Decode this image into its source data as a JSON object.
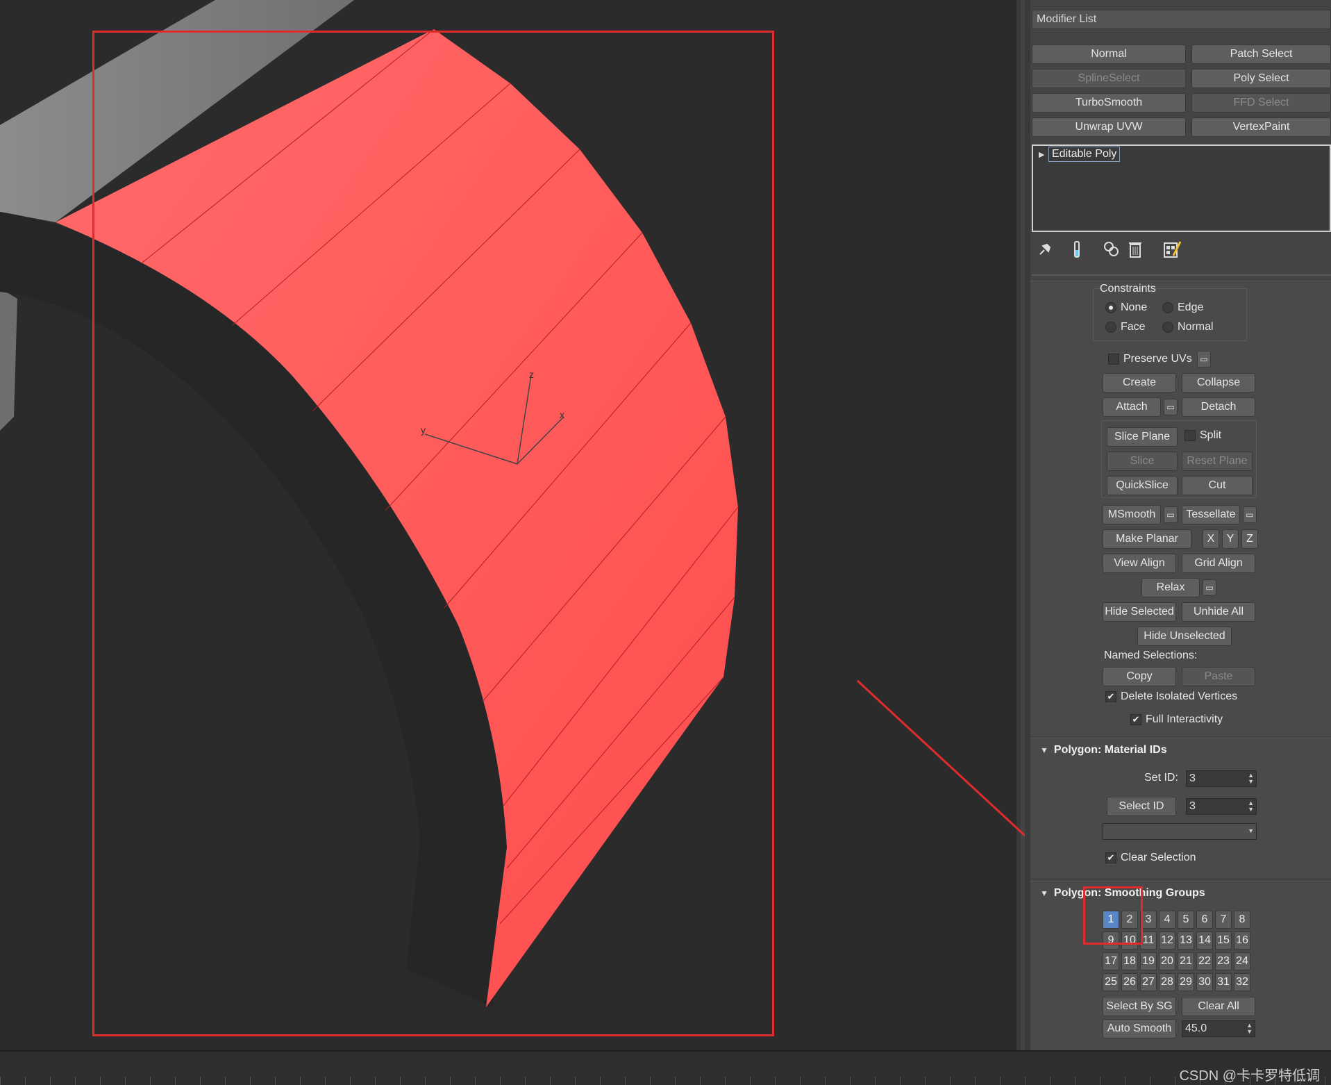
{
  "colors": {
    "selection_red": "#ff6060",
    "annotation_red": "#e02c2c",
    "panel_bg": "#444444",
    "viewport_bg": "#2b2b2b",
    "active_sg": "#5a86c5"
  },
  "viewport": {
    "gizmo": {
      "z": "z",
      "x": "x",
      "y": "y"
    }
  },
  "modifier_list": {
    "label": "Modifier List"
  },
  "modifier_buttons": {
    "normal": "Normal",
    "patch_select": "Patch Select",
    "spline_select": "SplineSelect",
    "poly_select": "Poly Select",
    "turbosmooth": "TurboSmooth",
    "ffd_select": "FFD Select",
    "unwrap_uvw": "Unwrap UVW",
    "vertexpaint": "VertexPaint"
  },
  "stack": {
    "item": "Editable Poly"
  },
  "stack_tools": [
    "pin-stack-icon",
    "show-end-result-icon",
    "make-unique-icon",
    "remove-modifier-icon",
    "configure-sets-icon"
  ],
  "edit_geometry": {
    "constraints_label": "Constraints",
    "constraints": {
      "none": "None",
      "edge": "Edge",
      "face": "Face",
      "normal": "Normal"
    },
    "preserve_uvs": "Preserve UVs",
    "create": "Create",
    "collapse": "Collapse",
    "attach": "Attach",
    "detach": "Detach",
    "slice_plane": "Slice Plane",
    "split": "Split",
    "slice": "Slice",
    "reset_plane": "Reset Plane",
    "quickslice": "QuickSlice",
    "cut": "Cut",
    "msmooth": "MSmooth",
    "tessellate": "Tessellate",
    "make_planar": "Make Planar",
    "x": "X",
    "y": "Y",
    "z": "Z",
    "view_align": "View Align",
    "grid_align": "Grid Align",
    "relax": "Relax",
    "hide_selected": "Hide Selected",
    "unhide_all": "Unhide All",
    "hide_unselected": "Hide Unselected",
    "named_selections": "Named Selections:",
    "copy": "Copy",
    "paste": "Paste",
    "delete_isolated": "Delete Isolated Vertices",
    "full_interactivity": "Full Interactivity"
  },
  "material_ids": {
    "title": "Polygon: Material IDs",
    "set_id_label": "Set ID:",
    "set_id_value": "3",
    "select_id": "Select ID",
    "select_id_value": "3",
    "clear_selection": "Clear Selection"
  },
  "smoothing_groups": {
    "title": "Polygon: Smoothing Groups",
    "groups": [
      "1",
      "2",
      "3",
      "4",
      "5",
      "6",
      "7",
      "8",
      "9",
      "10",
      "11",
      "12",
      "13",
      "14",
      "15",
      "16",
      "17",
      "18",
      "19",
      "20",
      "21",
      "22",
      "23",
      "24",
      "25",
      "26",
      "27",
      "28",
      "29",
      "30",
      "31",
      "32"
    ],
    "active_group": "1",
    "select_by_sg": "Select By SG",
    "clear_all": "Clear All",
    "auto_smooth": "Auto Smooth",
    "auto_smooth_value": "45.0"
  },
  "watermark": "CSDN @卡卡罗特低调"
}
